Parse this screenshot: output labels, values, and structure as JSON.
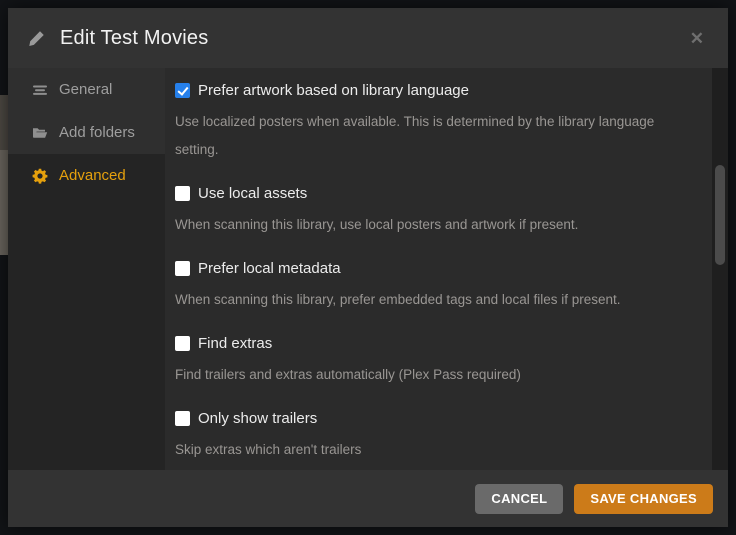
{
  "colors": {
    "accent_gold": "#e5a00d",
    "save_button_orange": "#cc7b19",
    "cancel_button_gray": "#6a6a6a",
    "checkbox_checked_blue": "#2680eb"
  },
  "header": {
    "title": "Edit Test Movies",
    "edit_icon": "pencil-icon",
    "close_icon": "close-icon",
    "close_glyph": "✕"
  },
  "sidebar": {
    "items": [
      {
        "label": "General",
        "icon": "list-lines-icon",
        "selected": false
      },
      {
        "label": "Add folders",
        "icon": "folder-open-icon",
        "selected": false
      },
      {
        "label": "Advanced",
        "icon": "gear-icon",
        "selected": true
      }
    ]
  },
  "content": {
    "fields": [
      {
        "label": "Prefer artwork based on library language",
        "checked": true,
        "description": "Use localized posters when available. This is determined by the library language setting."
      },
      {
        "label": "Use local assets",
        "checked": false,
        "description": "When scanning this library, use local posters and artwork if present."
      },
      {
        "label": "Prefer local metadata",
        "checked": false,
        "description": "When scanning this library, prefer embedded tags and local files if present."
      },
      {
        "label": "Find extras",
        "checked": false,
        "description": "Find trailers and extras automatically (Plex Pass required)"
      },
      {
        "label": "Only show trailers",
        "checked": false,
        "description": "Skip extras which aren't trailers"
      }
    ]
  },
  "footer": {
    "cancel_label": "CANCEL",
    "save_label": "SAVE CHANGES"
  }
}
